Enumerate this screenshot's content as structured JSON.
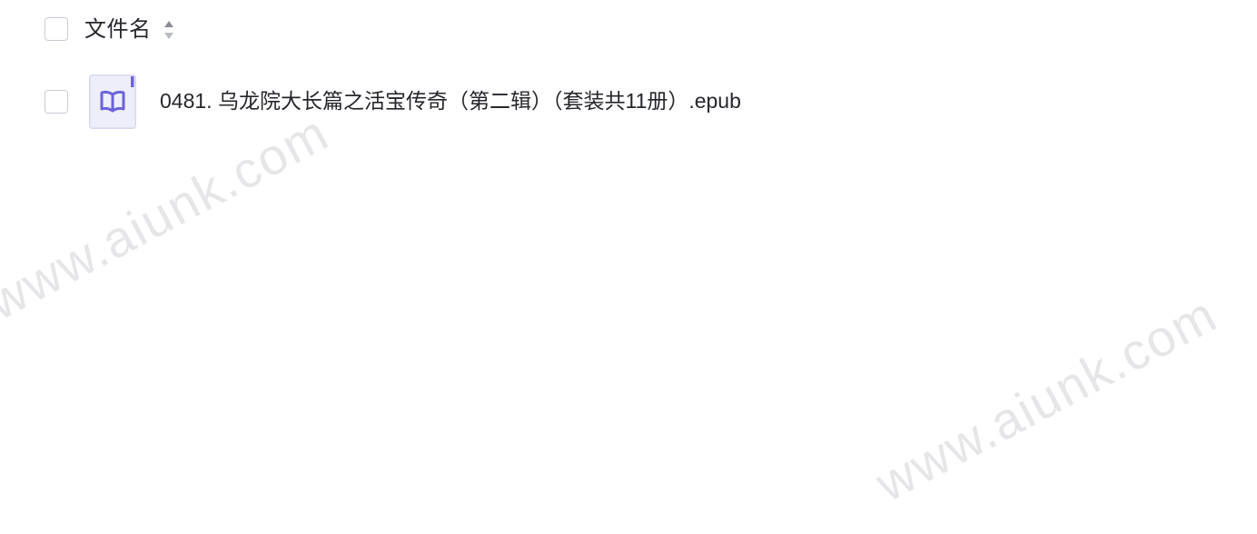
{
  "header": {
    "column_label": "文件名",
    "sort_icon": "sort-up-down-icon"
  },
  "files": [
    {
      "name": "0481. 乌龙院大长篇之活宝传奇（第二辑）（套装共11册）.epub",
      "icon": "epub-book-icon",
      "icon_color": "#6b63d8"
    }
  ],
  "watermark": {
    "text": "www.aiunk.com"
  },
  "colors": {
    "text": "#25262b",
    "checkbox_border": "#c9ccd4",
    "icon_accent": "#6b63d8",
    "icon_bg": "#eeeefb",
    "watermark": "#e6e6e9"
  }
}
